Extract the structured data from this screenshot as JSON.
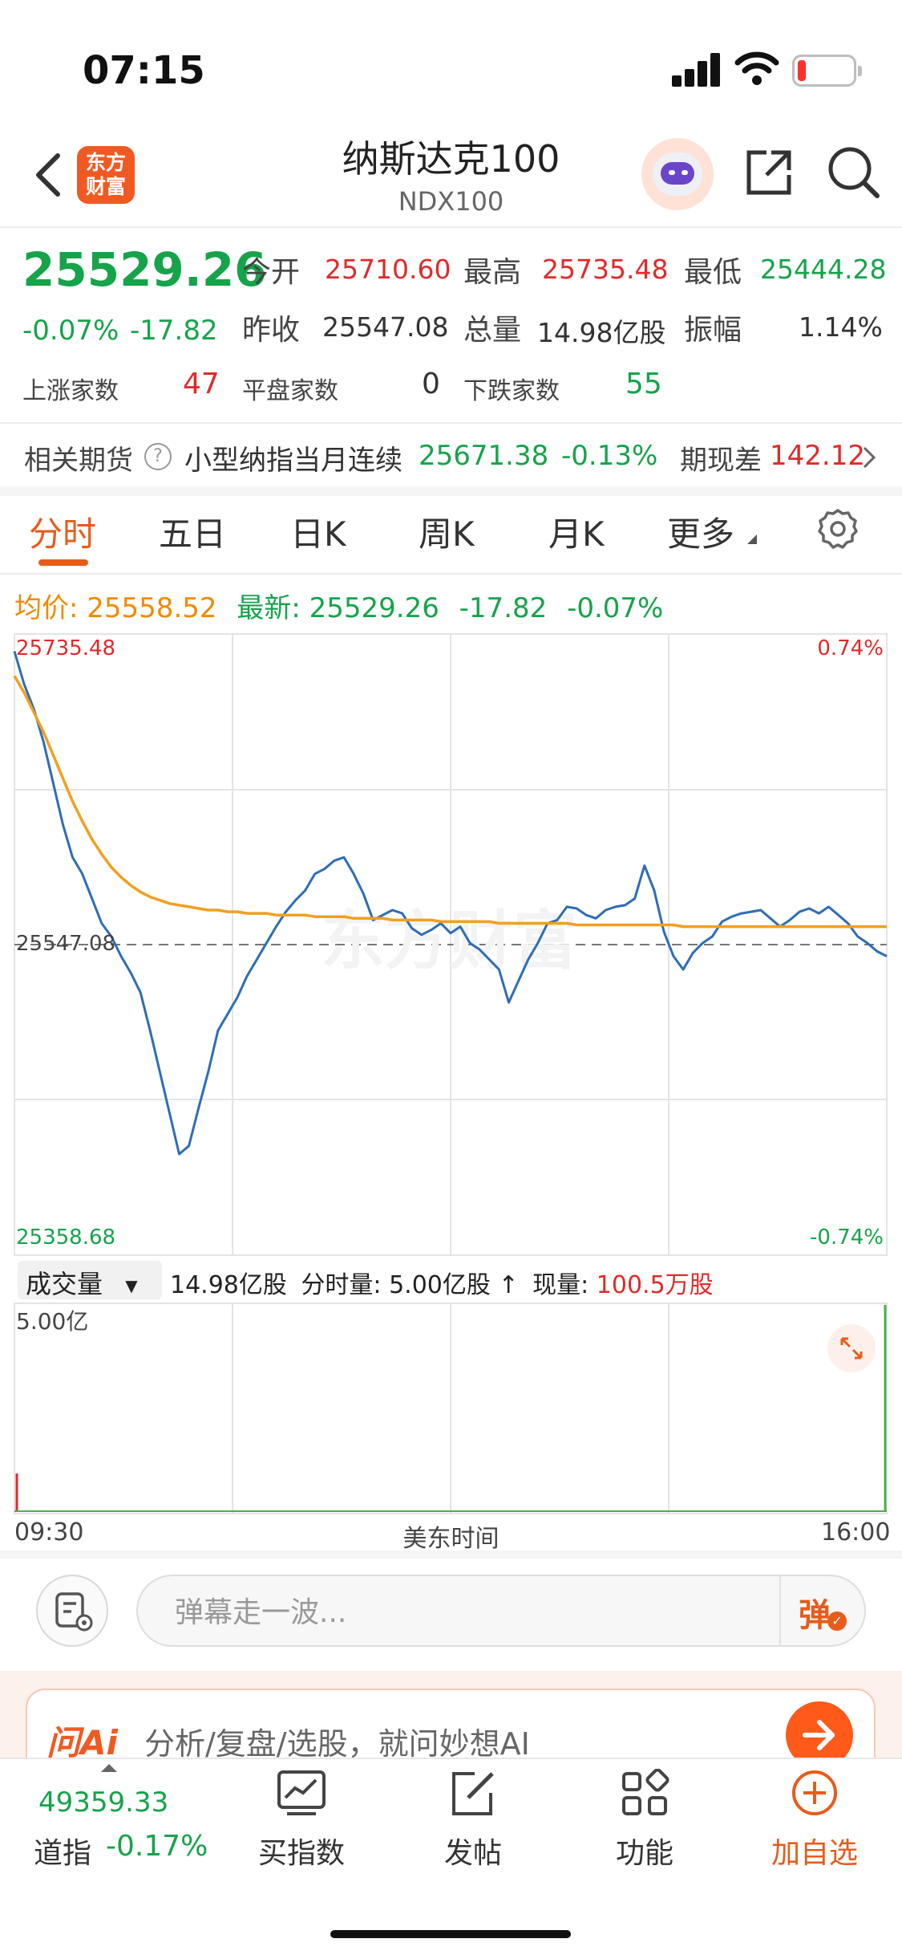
{
  "status_bar": {
    "time": "07:15"
  },
  "header": {
    "logo_text": "东方\n财富",
    "title": "纳斯达克100",
    "subtitle": "NDX100"
  },
  "quote": {
    "price": "25529.26",
    "change_pct": "-0.07%",
    "change": "-17.82",
    "open_label": "今开",
    "open": "25710.60",
    "high_label": "最高",
    "high": "25735.48",
    "low_label": "最低",
    "low": "25444.28",
    "prev_close_label": "昨收",
    "prev_close": "25547.08",
    "volume_label": "总量",
    "volume": "14.98亿股",
    "amplitude_label": "振幅",
    "amplitude": "1.14%",
    "up_label": "上涨家数",
    "up_count": "47",
    "flat_label": "平盘家数",
    "flat_count": "0",
    "down_label": "下跌家数",
    "down_count": "55"
  },
  "futures": {
    "label": "相关期货",
    "info_icon": "?",
    "name": "小型纳指当月连续",
    "price": "25671.38",
    "change_pct": "-0.13%",
    "basis_label": "期现差",
    "basis": "142.12"
  },
  "tabs": [
    "分时",
    "五日",
    "日K",
    "周K",
    "月K",
    "更多"
  ],
  "chart_summary": {
    "avg_label": "均价:",
    "avg": "25558.52",
    "latest_label": "最新:",
    "latest": "25529.26",
    "change": "-17.82",
    "change_pct": "-0.07%"
  },
  "chart_data": {
    "type": "line",
    "x_start": "09:30",
    "x_end": "16:00",
    "xlabel": "美东时间",
    "ylim": [
      25358.68,
      25735.48
    ],
    "y_max_label": "25735.48",
    "y_min_label": "25358.68",
    "prev_close_label": "25547.08",
    "pct_top": "0.74%",
    "pct_bottom": "-0.74%",
    "prev_close": 25547.08,
    "series": [
      {
        "color": "#2f6db5",
        "values": [
          25725,
          25705,
          25690,
          25670,
          25645,
          25620,
          25600,
          25590,
          25575,
          25560,
          25552,
          25540,
          25530,
          25518,
          25495,
          25470,
          25445,
          25420,
          25425,
          25448,
          25470,
          25495,
          25505,
          25515,
          25528,
          25538,
          25548,
          25558,
          25567,
          25574,
          25580,
          25590,
          25593,
          25598,
          25600,
          25590,
          25578,
          25562,
          25565,
          25568,
          25566,
          25557,
          25553,
          25556,
          25560,
          25554,
          25558,
          25548,
          25544,
          25538,
          25532,
          25512,
          25525,
          25538,
          25548,
          25560,
          25562,
          25570,
          25569,
          25565,
          25563,
          25568,
          25570,
          25571,
          25575,
          25595,
          25580,
          25555,
          25540,
          25532,
          25542,
          25548,
          25552,
          25561,
          25564,
          25566,
          25567,
          25568,
          25563,
          25558,
          25562,
          25567,
          25569,
          25566,
          25570,
          25565,
          25560,
          25552,
          25548,
          25543,
          25540
        ]
      },
      {
        "color": "#f0a020",
        "values": [
          25710,
          25700,
          25688,
          25676,
          25662,
          25648,
          25634,
          25622,
          25611,
          25602,
          25594,
          25588,
          25583,
          25579,
          25576,
          25574,
          25572,
          25571,
          25570,
          25569,
          25568,
          25568,
          25567,
          25567,
          25566,
          25566,
          25566,
          25565,
          25565,
          25565,
          25565,
          25564,
          25564,
          25564,
          25564,
          25563,
          25563,
          25563,
          25563,
          25562,
          25562,
          25562,
          25562,
          25562,
          25561,
          25561,
          25561,
          25561,
          25561,
          25561,
          25560,
          25560,
          25560,
          25560,
          25560,
          25560,
          25560,
          25560,
          25559,
          25559,
          25559,
          25559,
          25559,
          25559,
          25559,
          25559,
          25559,
          25559,
          25559,
          25558,
          25558,
          25558,
          25558,
          25558,
          25558,
          25558,
          25558,
          25558,
          25558,
          25558,
          25558,
          25558,
          25558,
          25558,
          25558,
          25558,
          25558,
          25558,
          25558,
          25558,
          25558
        ]
      }
    ]
  },
  "volume": {
    "selector_label": "成交量",
    "total": "14.98亿股",
    "minute_label": "分时量:",
    "minute_vol": "5.00亿股",
    "arrow": "↑",
    "current_label": "现量:",
    "current": "100.5万股",
    "max_label": "5.00亿"
  },
  "comment": {
    "placeholder": "弹幕走一波...",
    "danmu_label": "弹"
  },
  "ai_bar": {
    "logo": "问Ai",
    "text": "分析/复盘/选股，就问妙想AI"
  },
  "bottom_nav": {
    "index_value": "49359.33",
    "index_name": "道指",
    "index_change": "-0.17%",
    "items": [
      "买指数",
      "发帖",
      "功能",
      "加自选"
    ]
  },
  "colors": {
    "up": "#e02a2a",
    "down": "#16a34a",
    "accent": "#e65c1a",
    "avg_line": "#f0a020",
    "price_line": "#2f6db5"
  }
}
